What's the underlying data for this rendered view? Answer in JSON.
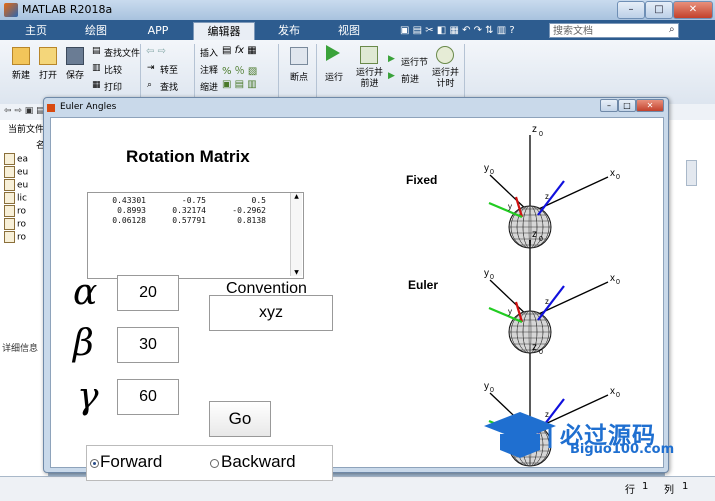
{
  "window": {
    "title": "MATLAB R2018a",
    "min": "–",
    "max": "□",
    "close": "✕"
  },
  "tabs": [
    "主页",
    "绘图",
    "APP",
    "编辑器",
    "发布",
    "视图"
  ],
  "active_tab": "编辑器",
  "search": {
    "placeholder": "搜索文档"
  },
  "ribbon": {
    "new": "新建",
    "open": "打开",
    "save": "保存",
    "find_files": "查找文件",
    "compare": "比较",
    "print": "打印",
    "goto": "转至",
    "find": "查找",
    "insert": "插入",
    "comment": "注释",
    "indent": "缩进",
    "breakpoints": "断点",
    "run": "运行",
    "run_advance": "运行并\n前进",
    "run_section": "运行节",
    "advance": "前进",
    "run_time": "运行并\n计时"
  },
  "left_panel": {
    "header": "当前文件",
    "col": "名",
    "files": [
      "ea",
      "eu",
      "eu",
      "lic",
      "ro",
      "ro",
      "ro"
    ],
    "details": "详细信息"
  },
  "status": {
    "row_label": "行",
    "row": "1",
    "col_label": "列",
    "col": "1"
  },
  "figure": {
    "title": "Euler Angles",
    "rotation_matrix_title": "Rotation Matrix",
    "matrix": [
      [
        "0.43301",
        "-0.75",
        "0.5"
      ],
      [
        "0.8993",
        "0.32174",
        "-0.2962"
      ],
      [
        "0.06128",
        "0.57791",
        "0.8138"
      ]
    ],
    "convention_label": "Convention",
    "convention": "xyz",
    "alpha_symbol": "α",
    "alpha": "20",
    "beta_symbol": "β",
    "beta": "30",
    "gamma_symbol": "γ",
    "gamma": "60",
    "go": "Go",
    "forward": "Forward",
    "backward": "Backward",
    "selected_direction": "Forward",
    "frames": [
      "Fixed",
      "Euler",
      ""
    ],
    "axis_labels": {
      "x": "x",
      "y": "y",
      "z": "z",
      "sub": "0"
    }
  },
  "watermark": {
    "text": "必过源码",
    "sub": "Biguo100.com"
  }
}
